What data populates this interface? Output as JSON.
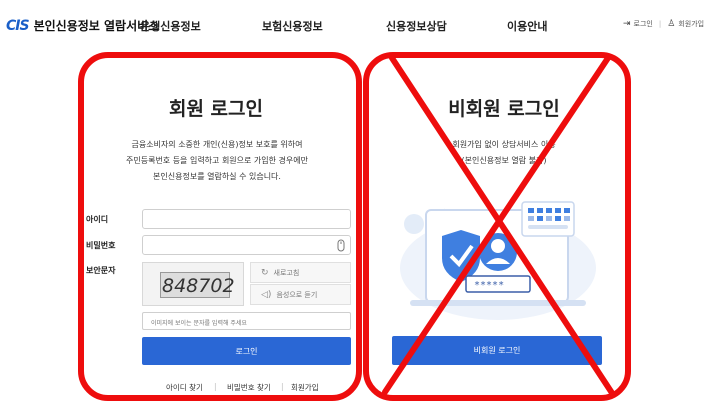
{
  "header": {
    "logo_mark": "CIS",
    "logo_text": "본인신용정보 열람서비스",
    "nav": [
      "은행신용정보",
      "보험신용정보",
      "신용정보상담",
      "이용안내"
    ],
    "util": {
      "login": "로그인",
      "join": "회원가입"
    }
  },
  "member": {
    "title": "회원 로그인",
    "desc": [
      "금융소비자의 소중한 개인(신용)정보 보호를 위하여",
      "주민등록번호 등을 입력하고 회원으로 가입한 경우에만",
      "본인신용정보를 열람하실 수 있습니다."
    ],
    "id_label": "아이디",
    "pw_label": "비밀번호",
    "captcha_label": "보안문자",
    "captcha_value": "848702",
    "refresh_label": "새로고침",
    "audio_label": "음성으로 듣기",
    "captcha_placeholder": "이미지에 보이는 문자를 입력해 주세요",
    "login_button": "로그인",
    "links": [
      "아이디 찾기",
      "비밀번호 찾기",
      "회원가입"
    ]
  },
  "guest": {
    "title": "비회원 로그인",
    "desc": [
      "회원가입 없이 상담서비스 이용",
      "(본인신용정보 열람 불가)"
    ],
    "password_mask": "*****",
    "login_button": "비회원 로그인"
  },
  "colors": {
    "brand": "#2a67d5",
    "annotation": "#ee0d0d"
  }
}
